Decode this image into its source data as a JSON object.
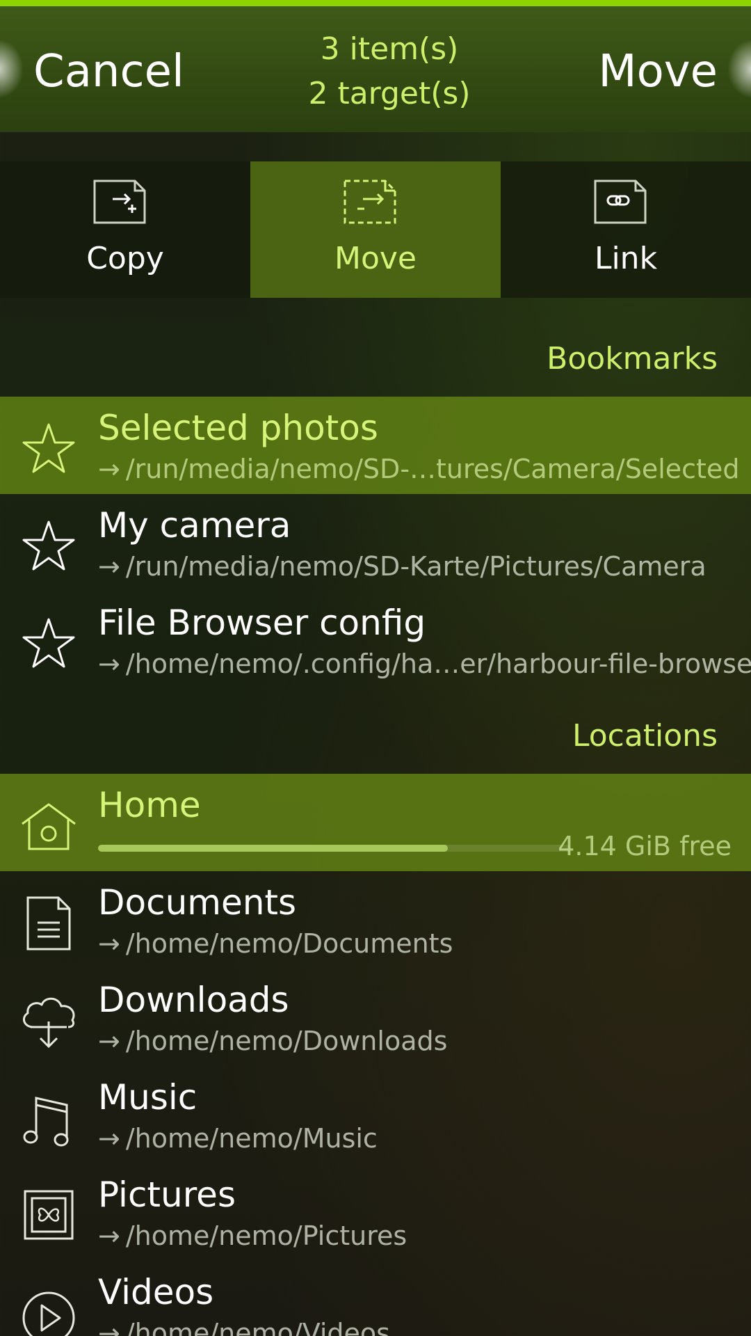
{
  "header": {
    "cancel_label": "Cancel",
    "accept_label": "Move",
    "items_line": "3 item(s)",
    "targets_line": "2 target(s)"
  },
  "modes": [
    {
      "label": "Copy",
      "icon": "copy-file-icon",
      "active": false
    },
    {
      "label": "Move",
      "icon": "move-file-icon",
      "active": true
    },
    {
      "label": "Link",
      "icon": "link-file-icon",
      "active": false
    }
  ],
  "bookmarks": {
    "heading": "Bookmarks",
    "items": [
      {
        "title": "Selected photos",
        "path": "/run/media/nemo/SD-…tures/Camera/Selected",
        "icon": "star-icon",
        "selected": true
      },
      {
        "title": "My camera",
        "path": "/run/media/nemo/SD-Karte/Pictures/Camera",
        "icon": "star-icon",
        "selected": false
      },
      {
        "title": "File Browser config",
        "path": "/home/nemo/.config/ha…er/harbour-file-browser",
        "icon": "star-icon",
        "selected": false
      }
    ]
  },
  "locations": {
    "heading": "Locations",
    "home": {
      "title": "Home",
      "free": "4.14 GiB free",
      "usage_fraction": 0.74,
      "icon": "home-icon",
      "selected": true
    },
    "items": [
      {
        "title": "Documents",
        "path": "/home/nemo/Documents",
        "icon": "document-icon"
      },
      {
        "title": "Downloads",
        "path": "/home/nemo/Downloads",
        "icon": "cloud-download-icon"
      },
      {
        "title": "Music",
        "path": "/home/nemo/Music",
        "icon": "music-note-icon"
      },
      {
        "title": "Pictures",
        "path": "/home/nemo/Pictures",
        "icon": "picture-icon"
      },
      {
        "title": "Videos",
        "path": "/home/nemo/Videos",
        "icon": "play-icon"
      }
    ]
  },
  "path_arrow": "→",
  "colors": {
    "accent": "#cdef6a",
    "highlight_bg": "#4a6414",
    "top_bar": "#8fd400"
  }
}
